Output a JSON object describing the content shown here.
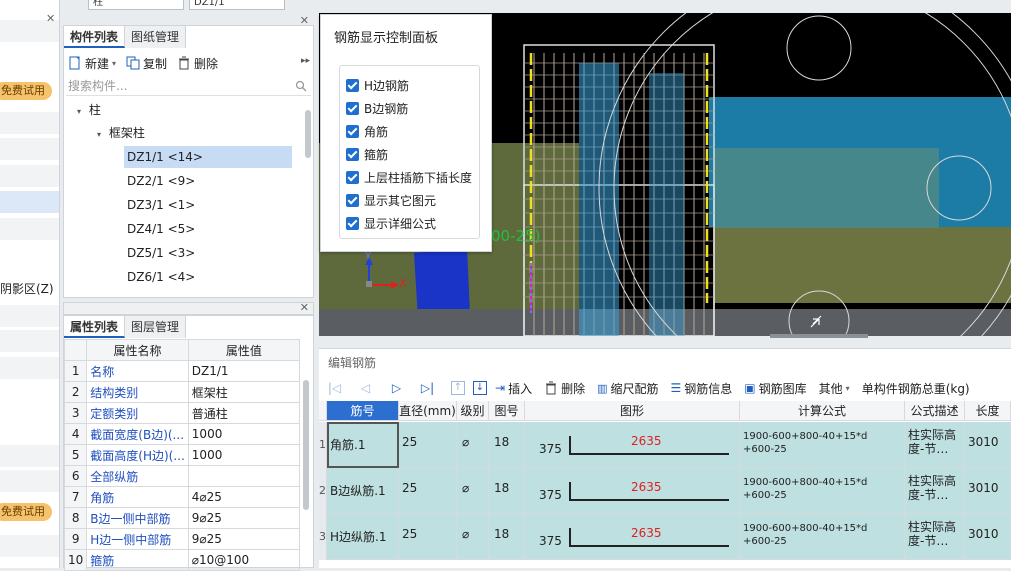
{
  "top_combos": {
    "left": "柱",
    "right": "DZ1/1"
  },
  "left_strip": {
    "trial_label": "免费试用",
    "mode_label": "阴影区(Z)"
  },
  "component_list": {
    "tabs": [
      "构件列表",
      "图纸管理"
    ],
    "toolbar": {
      "new_label": "新建",
      "copy_label": "复制",
      "delete_label": "删除"
    },
    "search_placeholder": "搜索构件...",
    "tree": {
      "root": "柱",
      "group": "框架柱",
      "items": [
        "DZ1/1 <14>",
        "DZ2/1 <9>",
        "DZ3/1 <1>",
        "DZ4/1 <5>",
        "DZ5/1 <3>",
        "DZ6/1 <4>"
      ],
      "selected_index": 0
    }
  },
  "property_list": {
    "tabs": [
      "属性列表",
      "图层管理"
    ],
    "headers": [
      "属性名称",
      "属性值"
    ],
    "rows": [
      {
        "idx": "1",
        "name": "名称",
        "value": "DZ1/1",
        "link": true
      },
      {
        "idx": "2",
        "name": "结构类别",
        "value": "框架柱",
        "link": true
      },
      {
        "idx": "3",
        "name": "定额类别",
        "value": "普通柱",
        "link": true
      },
      {
        "idx": "4",
        "name": "截面宽度(B边)(...",
        "value": "1000",
        "link": true
      },
      {
        "idx": "5",
        "name": "截面高度(H边)(...",
        "value": "1000",
        "link": true
      },
      {
        "idx": "6",
        "name": "全部纵筋",
        "value": "",
        "link": true
      },
      {
        "idx": "7",
        "name": "角筋",
        "value": "4⌀25",
        "link": true
      },
      {
        "idx": "8",
        "name": "B边一侧中部筋",
        "value": "9⌀25",
        "link": true
      },
      {
        "idx": "9",
        "name": "H边一侧中部筋",
        "value": "9⌀25",
        "link": true
      },
      {
        "idx": "10",
        "name": "箍筋",
        "value": "⌀10@100",
        "link": true
      }
    ]
  },
  "control_panel": {
    "title": "钢筋显示控制面板",
    "options": [
      {
        "label": "H边钢筋",
        "checked": true
      },
      {
        "label": "B边钢筋",
        "checked": true
      },
      {
        "label": "角筋",
        "checked": true
      },
      {
        "label": "箍筋",
        "checked": true
      },
      {
        "label": "上层柱插筋下插长度",
        "checked": true
      },
      {
        "label": "显示其它图元",
        "checked": true
      },
      {
        "label": "显示详细公式",
        "checked": true
      }
    ]
  },
  "viewport": {
    "green_label": "00-25)",
    "axis_y": "Y",
    "axis_x": "X"
  },
  "rebar_editor": {
    "title": "编辑钢筋",
    "toolbar": {
      "insert_label": "插入",
      "delete_label": "删除",
      "scale_label": "缩尺配筋",
      "info_label": "钢筋信息",
      "library_label": "钢筋图库",
      "other_label": "其他",
      "total_weight_label": "单构件钢筋总重(kg)"
    },
    "columns": [
      "筋号",
      "直径(mm)",
      "级别",
      "图号",
      "图形",
      "计算公式",
      "公式描述",
      "长度"
    ],
    "rows": [
      {
        "num": "1",
        "name": "角筋.1",
        "diameter": "25",
        "grade": "⌀",
        "fig": "18",
        "hook": "375",
        "shape_len": "2635",
        "formula1": "1900-600+800-40+15*d",
        "formula2": "+600-25",
        "desc1": "柱实际高",
        "desc2": "度-节…",
        "length": "3010"
      },
      {
        "num": "2",
        "name": "B边纵筋.1",
        "diameter": "25",
        "grade": "⌀",
        "fig": "18",
        "hook": "375",
        "shape_len": "2635",
        "formula1": "1900-600+800-40+15*d",
        "formula2": "+600-25",
        "desc1": "柱实际高",
        "desc2": "度-节…",
        "length": "3010"
      },
      {
        "num": "3",
        "name": "H边纵筋.1",
        "diameter": "25",
        "grade": "⌀",
        "fig": "18",
        "hook": "375",
        "shape_len": "2635",
        "formula1": "1900-600+800-40+15*d",
        "formula2": "+600-25",
        "desc1": "柱实际高",
        "desc2": "度-节…",
        "length": "3010"
      }
    ]
  },
  "colors": {
    "accent": "#1f6fd1",
    "row_bg": "#bee0e0",
    "trial": "#f5c36b",
    "shape_text": "#e02020"
  }
}
